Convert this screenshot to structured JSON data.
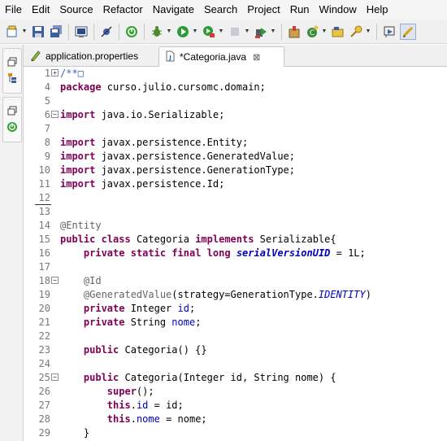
{
  "menu": [
    "File",
    "Edit",
    "Source",
    "Refactor",
    "Navigate",
    "Search",
    "Project",
    "Run",
    "Window",
    "Help"
  ],
  "tabs": [
    {
      "label": "application.properties",
      "active": false,
      "icon": "properties-file-icon"
    },
    {
      "label": "*Categoria.java",
      "active": true,
      "icon": "java-file-icon",
      "close": "⊠"
    }
  ],
  "editor": {
    "lines": [
      {
        "num": "1",
        "fold": "+",
        "tokens": [
          {
            "t": "/**",
            "c": "cm"
          },
          {
            "t": "□",
            "c": "cm"
          }
        ]
      },
      {
        "num": "4",
        "tokens": [
          {
            "t": "package",
            "c": "kw"
          },
          {
            "t": " curso.julio.cursomc.domain;"
          }
        ]
      },
      {
        "num": "5",
        "tokens": []
      },
      {
        "num": "6",
        "fold": "−",
        "tokens": [
          {
            "t": "import",
            "c": "kw"
          },
          {
            "t": " java.io.Serializable;"
          }
        ]
      },
      {
        "num": "7",
        "tokens": []
      },
      {
        "num": "8",
        "tokens": [
          {
            "t": "import",
            "c": "kw"
          },
          {
            "t": " javax.persistence.Entity;"
          }
        ]
      },
      {
        "num": "9",
        "tokens": [
          {
            "t": "import",
            "c": "kw"
          },
          {
            "t": " javax.persistence.GeneratedValue;"
          }
        ]
      },
      {
        "num": "10",
        "tokens": [
          {
            "t": "import",
            "c": "kw"
          },
          {
            "t": " javax.persistence.GenerationType;"
          }
        ]
      },
      {
        "num": "11",
        "tokens": [
          {
            "t": "import",
            "c": "kw"
          },
          {
            "t": " javax.persistence.Id;"
          }
        ]
      },
      {
        "num": "12",
        "cursor": true,
        "tokens": []
      },
      {
        "num": "13",
        "tokens": []
      },
      {
        "num": "14",
        "tokens": [
          {
            "t": "@Entity",
            "c": "ann"
          }
        ]
      },
      {
        "num": "15",
        "tokens": [
          {
            "t": "public",
            "c": "kw"
          },
          {
            "t": " "
          },
          {
            "t": "class",
            "c": "kw"
          },
          {
            "t": " Categoria "
          },
          {
            "t": "implements",
            "c": "kw"
          },
          {
            "t": " Serializable{"
          }
        ]
      },
      {
        "num": "16",
        "tokens": [
          {
            "t": "    "
          },
          {
            "t": "private",
            "c": "kw"
          },
          {
            "t": " "
          },
          {
            "t": "static",
            "c": "kw"
          },
          {
            "t": " "
          },
          {
            "t": "final",
            "c": "kw"
          },
          {
            "t": " "
          },
          {
            "t": "long",
            "c": "kw"
          },
          {
            "t": " "
          },
          {
            "t": "serialVersionUID",
            "c": "sfield"
          },
          {
            "t": " = 1L;"
          }
        ]
      },
      {
        "num": "17",
        "tokens": []
      },
      {
        "num": "18",
        "fold": "−",
        "tokens": [
          {
            "t": "    "
          },
          {
            "t": "@Id",
            "c": "ann"
          }
        ]
      },
      {
        "num": "19",
        "tokens": [
          {
            "t": "    "
          },
          {
            "t": "@GeneratedValue",
            "c": "ann"
          },
          {
            "t": "(strategy=GenerationType."
          },
          {
            "t": "IDENTITY",
            "c": "sconst"
          },
          {
            "t": ")"
          }
        ]
      },
      {
        "num": "20",
        "tokens": [
          {
            "t": "    "
          },
          {
            "t": "private",
            "c": "kw"
          },
          {
            "t": " Integer "
          },
          {
            "t": "id",
            "c": "field"
          },
          {
            "t": ";"
          }
        ]
      },
      {
        "num": "21",
        "tokens": [
          {
            "t": "    "
          },
          {
            "t": "private",
            "c": "kw"
          },
          {
            "t": " String "
          },
          {
            "t": "nome",
            "c": "field"
          },
          {
            "t": ";"
          }
        ]
      },
      {
        "num": "22",
        "tokens": []
      },
      {
        "num": "23",
        "tokens": [
          {
            "t": "    "
          },
          {
            "t": "public",
            "c": "kw"
          },
          {
            "t": " Categoria() {}"
          }
        ]
      },
      {
        "num": "24",
        "tokens": []
      },
      {
        "num": "25",
        "fold": "−",
        "tokens": [
          {
            "t": "    "
          },
          {
            "t": "public",
            "c": "kw"
          },
          {
            "t": " Categoria(Integer id, String nome) {"
          }
        ]
      },
      {
        "num": "26",
        "tokens": [
          {
            "t": "        "
          },
          {
            "t": "super",
            "c": "kw"
          },
          {
            "t": "();"
          }
        ]
      },
      {
        "num": "27",
        "tokens": [
          {
            "t": "        "
          },
          {
            "t": "this",
            "c": "kw"
          },
          {
            "t": "."
          },
          {
            "t": "id",
            "c": "field"
          },
          {
            "t": " = id;"
          }
        ]
      },
      {
        "num": "28",
        "tokens": [
          {
            "t": "        "
          },
          {
            "t": "this",
            "c": "kw"
          },
          {
            "t": "."
          },
          {
            "t": "nome",
            "c": "field"
          },
          {
            "t": " = nome;"
          }
        ]
      },
      {
        "num": "29",
        "tokens": [
          {
            "t": "    }"
          }
        ]
      }
    ]
  }
}
